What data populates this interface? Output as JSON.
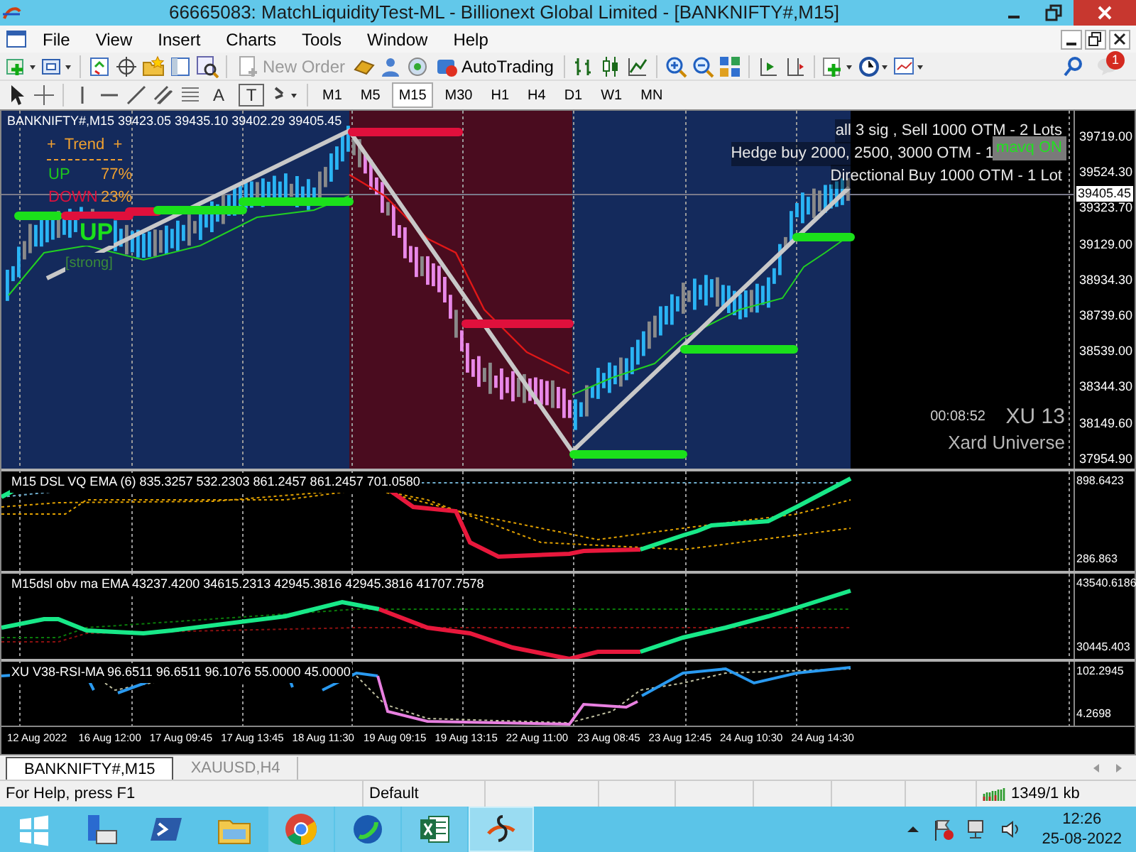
{
  "window": {
    "title": "66665083: MatchLiquidityTest-ML - Billionext Global Limited - [BANKNIFTY#,M15]"
  },
  "menu": [
    "File",
    "View",
    "Insert",
    "Charts",
    "Tools",
    "Window",
    "Help"
  ],
  "toolbar": {
    "new_order": {
      "label": "New Order",
      "disabled": true
    },
    "auto_trading": {
      "label": "AutoTrading",
      "disabled": false
    },
    "notification_count": "1"
  },
  "drawing_tools": [
    {
      "kind": "letter",
      "label": "A"
    },
    {
      "kind": "boxed",
      "label": "T"
    }
  ],
  "timeframes": [
    {
      "label": "M1",
      "selected": false
    },
    {
      "label": "M5",
      "selected": false
    },
    {
      "label": "M15",
      "selected": true
    },
    {
      "label": "M30",
      "selected": false
    },
    {
      "label": "H1",
      "selected": false
    },
    {
      "label": "H4",
      "selected": false
    },
    {
      "label": "D1",
      "selected": false
    },
    {
      "label": "W1",
      "selected": false
    },
    {
      "label": "MN",
      "selected": false
    }
  ],
  "chart": {
    "symbol_info": "BANKNIFTY#,M15  39423.05 39435.10 39402.29 39405.45",
    "trend_panel": {
      "title": "+  Trend  +",
      "rows": [
        {
          "label": "UP",
          "value": "77%",
          "color": "#1cc81c"
        },
        {
          "label": "DOWN",
          "value": "23%",
          "color": "#e0103c"
        }
      ],
      "signal": "UP",
      "strength": "[strong]"
    },
    "signals": [
      "all 3 sig , Sell 1000 OTM - 2 Lots",
      "Hedge buy 2000, 2500, 3000 OTM - 1",
      "Directional Buy 1000 OTM - 1 Lot"
    ],
    "badge": "mavq ON",
    "watermark": [
      "XU 13",
      "00:08:52",
      "Xard Universe"
    ],
    "price_axis": [
      "39719.00",
      "39524.30",
      "39323.70",
      "39129.00",
      "38934.30",
      "38739.60",
      "38539.00",
      "38344.30",
      "38149.60",
      "37954.90"
    ],
    "current_price": "39405.45",
    "indicators": [
      {
        "kind": "dsl",
        "label": "M15 DSL  VQ  EMA (6)  835.3257 532.2303 861.2457 861.2457 701.0580",
        "axis": [
          "898.6423",
          "286.863"
        ]
      },
      {
        "kind": "obv",
        "label": "M15dsl  obv ma  EMA  43237.4200 34615.2313 42945.3816 42945.3816 41707.7578",
        "axis": [
          "43540.6186",
          "30445.403"
        ]
      },
      {
        "kind": "rsi",
        "label": "XU V38-RSI-MA 96.6511 96.6511 96.1076 55.0000 45.0000",
        "axis": [
          "102.2945",
          "4.2698"
        ]
      }
    ],
    "time_axis": [
      "12 Aug 2022",
      "16 Aug 12:00",
      "17 Aug 09:45",
      "17 Aug 13:45",
      "18 Aug 11:30",
      "19 Aug 09:15",
      "19 Aug 13:15",
      "22 Aug 11:00",
      "23 Aug 08:45",
      "23 Aug 12:45",
      "24 Aug 10:30",
      "24 Aug 14:30"
    ]
  },
  "tabs": [
    {
      "label": "BANKNIFTY#,M15",
      "selected": true
    },
    {
      "label": "XAUUSD,H4",
      "selected": false
    }
  ],
  "status_bar": {
    "help": "For Help, press F1",
    "profile": "Default",
    "traffic": "1349/1 kb"
  },
  "taskbar": {
    "apps": [
      {
        "kind": "start",
        "selected": false
      },
      {
        "kind": "server",
        "selected": false
      },
      {
        "kind": "powershell",
        "selected": false
      },
      {
        "kind": "folder",
        "selected": false
      },
      {
        "kind": "chrome",
        "selected": false
      },
      {
        "kind": "globe",
        "selected": false
      },
      {
        "kind": "sheet",
        "selected": false
      },
      {
        "kind": "trading",
        "selected": true
      }
    ],
    "time": "12:26",
    "date": "25-08-2022"
  }
}
